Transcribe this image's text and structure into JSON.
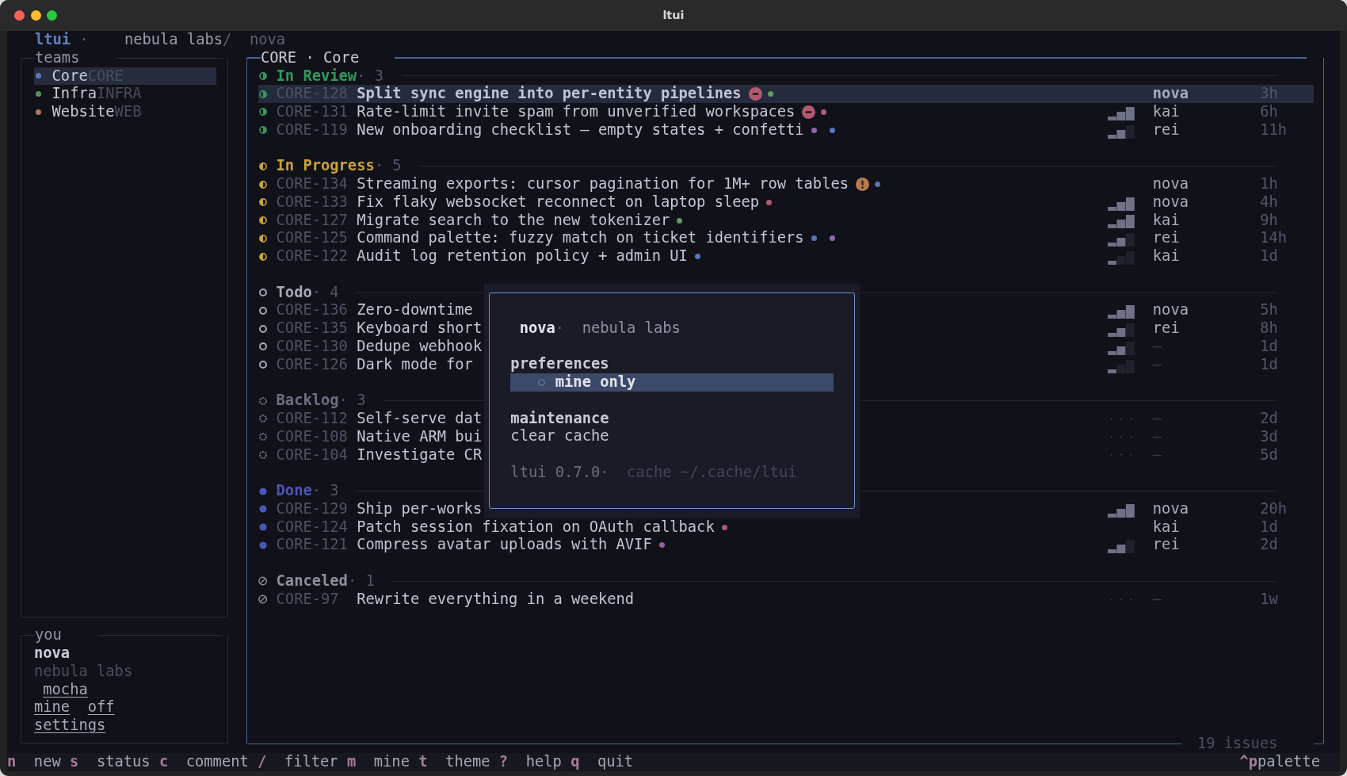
{
  "window": {
    "title": "ltui"
  },
  "header": {
    "app": "ltui",
    "dot": "·",
    "workspace": "nebula labs",
    "slash": "/",
    "user": "nova"
  },
  "sidebar": {
    "teams": {
      "title": "teams",
      "items": [
        {
          "name": "Core",
          "key": "CORE",
          "color": "#5b79b6",
          "selected": true
        },
        {
          "name": "Infra",
          "key": "INFRA",
          "color": "#5e8e60",
          "selected": false
        },
        {
          "name": "Website",
          "key": "WEB",
          "color": "#a8795b",
          "selected": false
        }
      ]
    },
    "you": {
      "title": "you",
      "name": "nova",
      "workspace": "nebula labs",
      "theme": "mocha",
      "mine": {
        "label": "mine",
        "value": "off"
      },
      "settings": "settings"
    }
  },
  "main": {
    "title": "CORE · Core",
    "footer": "19 issues",
    "groups": [
      {
        "kind": "review",
        "name": "In Review",
        "count": "· 3",
        "color": "#2f9a5c",
        "issues": [
          {
            "id": "CORE-128",
            "title": "Split sync engine into per-entity pipelines",
            "badge": {
              "kind": "blocked"
            },
            "labels": [
              {
                "color": "#5f9c62"
              }
            ],
            "assignee": "nova",
            "assigned": true,
            "time": "3h",
            "selected": true
          },
          {
            "id": "CORE-131",
            "title": "Rate-limit invite spam from unverified workspaces",
            "badge": {
              "kind": "blocked"
            },
            "labels": [
              {
                "color": "#b05a72"
              }
            ],
            "priority": {
              "kind": "high"
            },
            "assignee": "kai",
            "assigned": true,
            "time": "6h",
            "selected": false
          },
          {
            "id": "CORE-119",
            "title": "New onboarding checklist — empty states + confetti",
            "labels": [
              {
                "color": "#8d6aa8"
              },
              {
                "color": "#5676b5"
              }
            ],
            "priority": {
              "kind": "medium"
            },
            "assignee": "rei",
            "assigned": true,
            "time": "11h",
            "selected": false
          }
        ]
      },
      {
        "kind": "progress",
        "name": "In Progress",
        "count": "· 5",
        "color": "#c8a23c",
        "issues": [
          {
            "id": "CORE-134",
            "title": "Streaming exports: cursor pagination for 1M+ row tables",
            "badge": {
              "kind": "urgent"
            },
            "labels": [
              {
                "color": "#5676b5"
              }
            ],
            "assignee": "nova",
            "assigned": true,
            "time": "1h",
            "selected": false
          },
          {
            "id": "CORE-133",
            "title": "Fix flaky websocket reconnect on laptop sleep",
            "labels": [
              {
                "color": "#b05a72"
              }
            ],
            "priority": {
              "kind": "high"
            },
            "assignee": "nova",
            "assigned": true,
            "time": "4h",
            "selected": false
          },
          {
            "id": "CORE-127",
            "title": "Migrate search to the new tokenizer",
            "labels": [
              {
                "color": "#5f9c62"
              }
            ],
            "priority": {
              "kind": "high"
            },
            "assignee": "kai",
            "assigned": true,
            "time": "9h",
            "selected": false
          },
          {
            "id": "CORE-125",
            "title": "Command palette: fuzzy match on ticket identifiers",
            "labels": [
              {
                "color": "#5676b5"
              },
              {
                "color": "#8d6aa8"
              }
            ],
            "priority": {
              "kind": "medium"
            },
            "assignee": "rei",
            "assigned": true,
            "time": "14h",
            "selected": false
          },
          {
            "id": "CORE-122",
            "title": "Audit log retention policy + admin UI",
            "labels": [
              {
                "color": "#5676b5"
              }
            ],
            "priority": {
              "kind": "low"
            },
            "assignee": "kai",
            "assigned": true,
            "time": "1d",
            "selected": false
          }
        ]
      },
      {
        "kind": "todo",
        "name": "Todo",
        "count": "· 4",
        "color": "#a6a9b6",
        "issues": [
          {
            "id": "CORE-136",
            "title": "Zero-downtime",
            "priority": {
              "kind": "high"
            },
            "assignee": "nova",
            "assigned": true,
            "time": "5h",
            "selected": false
          },
          {
            "id": "CORE-135",
            "title": "Keyboard short",
            "priority": {
              "kind": "medium"
            },
            "assignee": "rei",
            "assigned": true,
            "time": "8h",
            "selected": false
          },
          {
            "id": "CORE-130",
            "title": "Dedupe webhook",
            "priority": {
              "kind": "medium"
            },
            "assignee": "—",
            "assigned": false,
            "time": "1d",
            "selected": false
          },
          {
            "id": "CORE-126",
            "title": "Dark mode for",
            "priority": {
              "kind": "low"
            },
            "assignee": "—",
            "assigned": false,
            "time": "1d",
            "selected": false
          }
        ]
      },
      {
        "kind": "backlog",
        "name": "Backlog",
        "count": "· 3",
        "color": "#6c6f80",
        "issues": [
          {
            "id": "CORE-112",
            "title": "Self-serve dat",
            "priority": {
              "kind": "none"
            },
            "assignee": "—",
            "assigned": false,
            "time": "2d",
            "selected": false
          },
          {
            "id": "CORE-108",
            "title": "Native ARM bui",
            "priority": {
              "kind": "none"
            },
            "assignee": "—",
            "assigned": false,
            "time": "3d",
            "selected": false
          },
          {
            "id": "CORE-104",
            "title": "Investigate CR",
            "priority": {
              "kind": "none"
            },
            "assignee": "—",
            "assigned": false,
            "time": "5d",
            "selected": false
          }
        ]
      },
      {
        "kind": "done",
        "name": "Done",
        "count": "· 3",
        "color": "#4b56b8",
        "issues": [
          {
            "id": "CORE-129",
            "title": "Ship per-works",
            "priority": {
              "kind": "high"
            },
            "assignee": "nova",
            "assigned": true,
            "time": "20h",
            "selected": false
          },
          {
            "id": "CORE-124",
            "title": "Patch session fixation on OAuth callback",
            "labels": [
              {
                "color": "#b05a72"
              }
            ],
            "assignee": "kai",
            "assigned": true,
            "time": "1d",
            "selected": false
          },
          {
            "id": "CORE-121",
            "title": "Compress avatar uploads with AVIF",
            "labels": [
              {
                "color": "#9a5f94"
              }
            ],
            "priority": {
              "kind": "medium"
            },
            "assignee": "rei",
            "assigned": true,
            "time": "2d",
            "selected": false
          }
        ]
      },
      {
        "kind": "canceled",
        "name": "Canceled",
        "count": "· 1",
        "color": "#8d8f9b",
        "issues": [
          {
            "id": "CORE-97",
            "title": "Rewrite everything in a weekend",
            "priority": {
              "kind": "none"
            },
            "assignee": "—",
            "assigned": false,
            "time": "1w",
            "selected": false
          }
        ]
      }
    ]
  },
  "popup": {
    "user": "nova",
    "sep": "·",
    "workspace": "nebula labs",
    "sections": [
      {
        "title": "preferences",
        "items": [
          {
            "kind": "toggle",
            "label": "mine only",
            "checked": false,
            "selected": true
          }
        ]
      },
      {
        "title": "maintenance",
        "items": [
          {
            "kind": "action",
            "label": "clear cache",
            "selected": false
          }
        ]
      }
    ],
    "footer": {
      "version": "ltui 0.7.0",
      "sep": "·",
      "cache": "cache ~/.cache/ltui"
    }
  },
  "status_bar": {
    "shortcuts": [
      {
        "key": "n",
        "label": "new"
      },
      {
        "key": "s",
        "label": "status"
      },
      {
        "key": "c",
        "label": "comment"
      },
      {
        "key": "/",
        "label": "filter"
      },
      {
        "key": "m",
        "label": "mine"
      },
      {
        "key": "t",
        "label": "theme"
      },
      {
        "key": "?",
        "label": "help"
      },
      {
        "key": "q",
        "label": "quit"
      }
    ],
    "palette": {
      "key": "^p",
      "label": "palette"
    }
  }
}
